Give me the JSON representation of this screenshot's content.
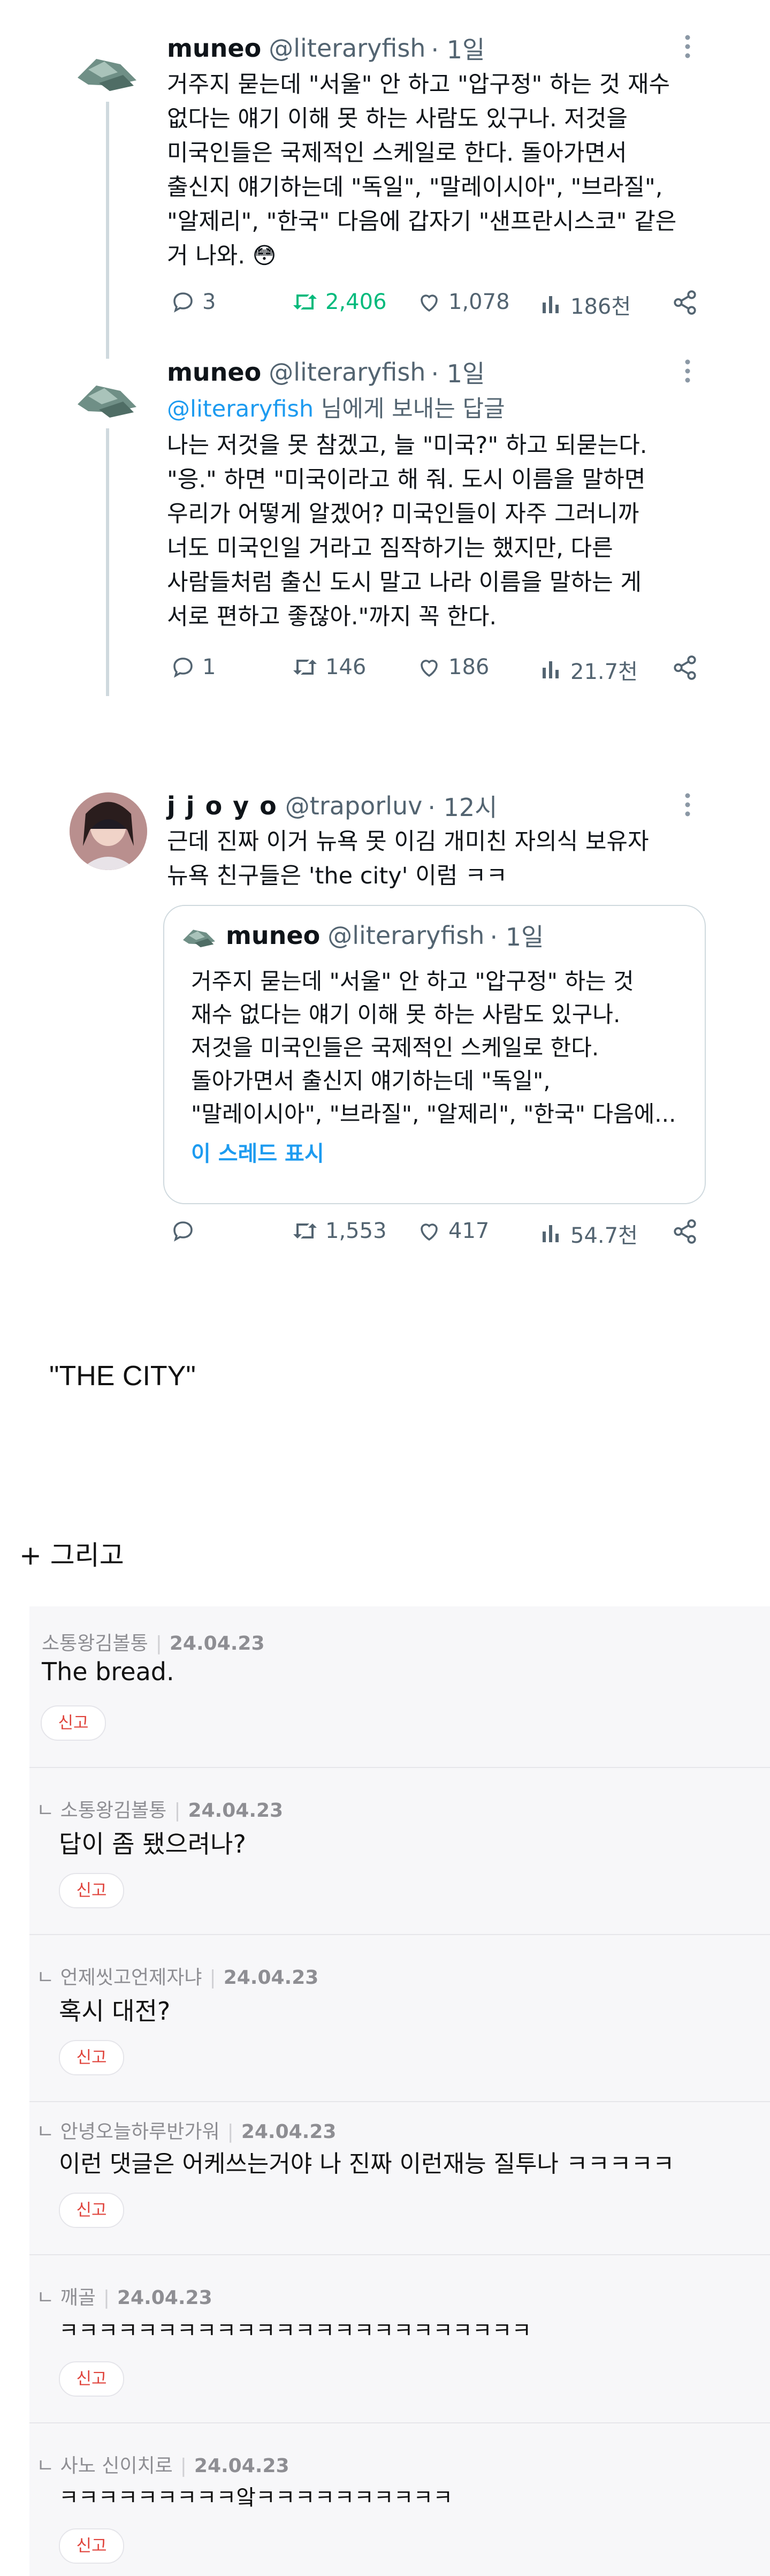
{
  "tweets": [
    {
      "name": "muneo",
      "handle": "@literaryfish",
      "time": "· 1일",
      "text": "거주지 묻는데 \"서울\" 안 하고 \"압구정\" 하는 것 재수\n없다는 얘기 이해 못 하는 사람도 있구나. 저것을\n미국인들은 국제적인 스케일로 한다. 돌아가면서\n출신지 얘기하는데 \"독일\", \"말레이시아\", \"브라질\",\n\"알제리\", \"한국\" 다음에 갑자기 \"샌프란시스코\" 같은\n거 나와. 😳",
      "replies": "3",
      "retweets": "2,406",
      "likes": "1,078",
      "views": "186천"
    },
    {
      "name": "muneo",
      "handle": "@literaryfish",
      "time": "· 1일",
      "reply_to_handle": "@literaryfish",
      "reply_to_suffix": " 님에게 보내는 답글",
      "text": "나는 저것을 못 참겠고, 늘 \"미국?\" 하고 되묻는다.\n\"응.\" 하면 \"미국이라고 해 줘. 도시 이름을 말하면\n우리가 어떻게 알겠어? 미국인들이 자주 그러니까\n너도 미국인일 거라고 짐작하기는 했지만, 다른\n사람들처럼 출신 도시 말고 나라 이름을 말하는 게\n서로 편하고 좋잖아.\"까지 꼭 한다.",
      "replies": "1",
      "retweets": "146",
      "likes": "186",
      "views": "21.7천"
    },
    {
      "name": "j j o y o",
      "handle": "@traporluv",
      "time": "· 12시",
      "text": "근데 진짜 이거 뉴욕 못 이김 개미친 자의식 보유자\n뉴욕 친구들은 'the city' 이럼 ㅋㅋ",
      "replies": "",
      "retweets": "1,553",
      "likes": "417",
      "views": "54.7천",
      "quote": {
        "name": "muneo",
        "handle": "@literaryfish",
        "time": "· 1일",
        "text": "거주지 묻는데 \"서울\" 안 하고 \"압구정\" 하는 것\n재수 없다는 얘기 이해 못 하는 사람도 있구나.\n저것을 미국인들은 국제적인 스케일로 한다.\n돌아가면서 출신지 얘기하는데 \"독일\",\n\"말레이시아\", \"브라질\", \"알제리\", \"한국\" 다음에...",
        "show_thread": "이 스레드 표시"
      }
    }
  ],
  "caption1": "\"THE CITY\"",
  "caption2": "+ 그리고",
  "comments": [
    {
      "prefix": "",
      "user": "소통왕김볼통",
      "date": "24.04.23",
      "text": "The bread.",
      "report": "신고"
    },
    {
      "prefix": "ㄴ ",
      "user": "소통왕김볼통",
      "date": "24.04.23",
      "text": "답이 좀 됐으려나?",
      "report": "신고"
    },
    {
      "prefix": "ㄴ ",
      "user": "언제씻고언제자냐",
      "date": "24.04.23",
      "text": "혹시 대전?",
      "report": "신고"
    },
    {
      "prefix": "ㄴ ",
      "user": "안녕오늘하루반가워",
      "date": "24.04.23",
      "text": "이런 댓글은 어케쓰는거야 나 진짜 이런재능 질투나 ㅋㅋㅋㅋㅋ",
      "report": "신고"
    },
    {
      "prefix": "ㄴ ",
      "user": "깨골",
      "date": "24.04.23",
      "text": "ㅋㅋㅋㅋㅋㅋㅋㅋㅋㅋㅋㅋㅋㅋㅋㅋㅋㅋㅋㅋㅋㅋㅋㅋ",
      "report": "신고"
    },
    {
      "prefix": "ㄴ ",
      "user": "사노 신이치로",
      "date": "24.04.23",
      "text": "ㅋㅋㅋㅋㅋㅋㅋㅋㅋ앜ㅋㅋㅋㅋㅋㅋㅋㅋㅋㅋ",
      "report": "신고"
    }
  ],
  "colors": {
    "accent": "#1d9bf0",
    "retweet_active": "#00ba7c",
    "report_red": "#e0443c"
  }
}
